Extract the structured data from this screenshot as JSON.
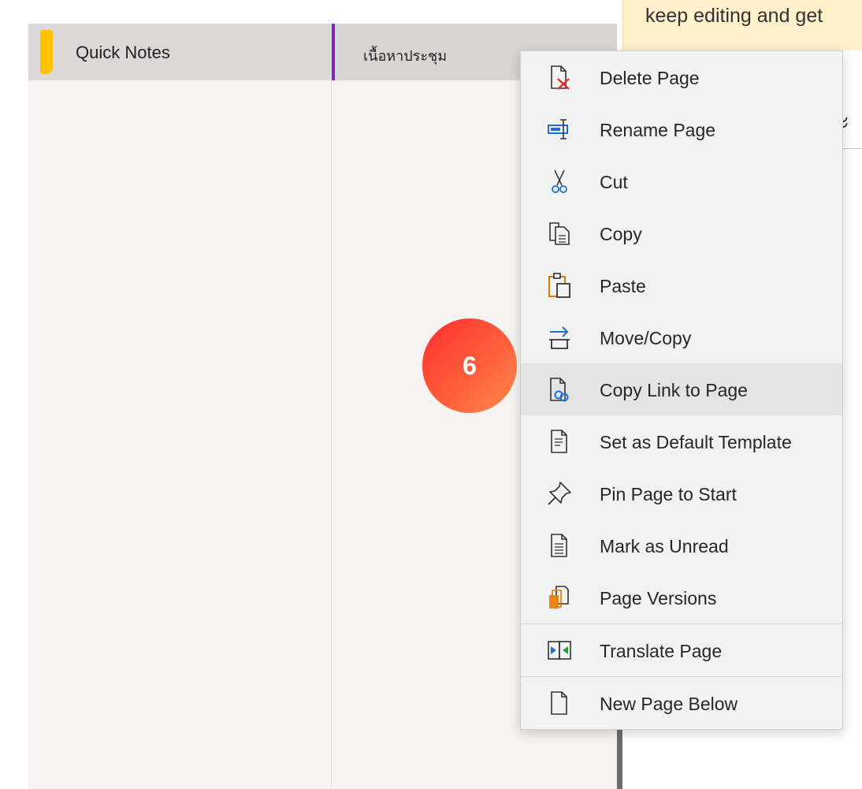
{
  "banner": {
    "text": "keep editing and get"
  },
  "sections": [
    {
      "label": "Quick Notes",
      "color": "#ffc000"
    }
  ],
  "pages": [
    {
      "label": "เนื้อหาประชุม",
      "accent": "#7a2bb6"
    }
  ],
  "canvas": {
    "title_fragment": "ะ"
  },
  "context_menu": {
    "items": [
      {
        "label": "Delete Page",
        "icon": "delete-page-icon"
      },
      {
        "label": "Rename Page",
        "icon": "rename-page-icon"
      },
      {
        "label": "Cut",
        "icon": "scissors-icon"
      },
      {
        "label": "Copy",
        "icon": "copy-icon"
      },
      {
        "label": "Paste",
        "icon": "paste-icon"
      },
      {
        "label": "Move/Copy",
        "icon": "move-copy-icon"
      },
      {
        "label": "Copy Link to Page",
        "icon": "copy-link-icon",
        "highlighted": true
      },
      {
        "label": "Set as Default Template",
        "icon": "template-icon"
      },
      {
        "label": "Pin Page to Start",
        "icon": "pin-icon"
      },
      {
        "label": "Mark as Unread",
        "icon": "unread-icon"
      },
      {
        "label": "Page Versions",
        "icon": "page-versions-icon"
      },
      {
        "label": "Translate Page",
        "icon": "translate-icon"
      },
      {
        "label": "New Page Below",
        "icon": "new-page-icon"
      }
    ]
  },
  "step_badge": {
    "number": "6"
  },
  "colors": {
    "accent_purple": "#7a2bb6",
    "section_yellow": "#ffc000",
    "banner_bg": "#fff1cc",
    "badge_gradient_start": "#ff2d2d",
    "badge_gradient_end": "#ff8a4a"
  }
}
